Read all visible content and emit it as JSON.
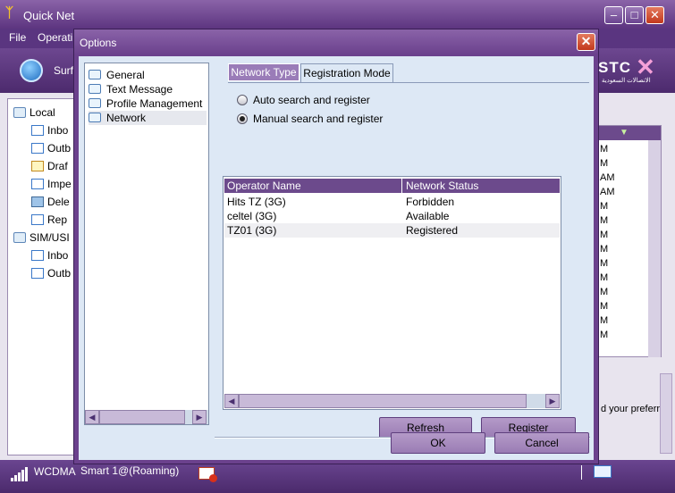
{
  "app": {
    "title": "Quick Net",
    "menu": [
      "File",
      "Operati"
    ],
    "toolbar_label": "Surf",
    "brand": {
      "name": "STC",
      "tagline": "الاتصالات السعودية"
    },
    "tree": [
      {
        "label": "Local",
        "icon": "folder-icon"
      },
      {
        "label": "Inbo",
        "icon": "inbox-icon"
      },
      {
        "label": "Outb",
        "icon": "outbox-icon"
      },
      {
        "label": "Draf",
        "icon": "drafts-icon"
      },
      {
        "label": "Impe",
        "icon": "important-icon"
      },
      {
        "label": "Dele",
        "icon": "trash-icon"
      },
      {
        "label": "Rep",
        "icon": "report-icon"
      },
      {
        "label": "SIM/USI",
        "icon": "folder-icon"
      },
      {
        "label": "Inbo",
        "icon": "inbox-icon"
      },
      {
        "label": "Outb",
        "icon": "outbox-icon"
      }
    ],
    "list_times": [
      "M",
      "M",
      "AM",
      "AM",
      "M",
      "M",
      "M",
      "M",
      "M",
      "M",
      "M",
      "M",
      "M",
      "M"
    ],
    "side_note": "d your preferr"
  },
  "statusbar": {
    "network_type": "WCDMA",
    "operator": "Smart 1@(Roaming)"
  },
  "dialog": {
    "title": "Options",
    "tree": [
      {
        "label": "General",
        "selected": false
      },
      {
        "label": "Text Message",
        "selected": false
      },
      {
        "label": "Profile Management",
        "selected": false
      },
      {
        "label": "Network",
        "selected": true
      }
    ],
    "tabs": [
      {
        "label": "Network Type",
        "active": false
      },
      {
        "label": "Registration Mode",
        "active": true
      }
    ],
    "radios": [
      {
        "label": "Auto search and register",
        "checked": false
      },
      {
        "label": "Manual search and register",
        "checked": true
      }
    ],
    "table": {
      "headers": [
        "Operator Name",
        "Network Status"
      ],
      "rows": [
        [
          "Hits TZ (3G)",
          "Forbidden"
        ],
        [
          "celtel (3G)",
          "Available"
        ],
        [
          "TZ01 (3G)",
          "Registered"
        ]
      ]
    },
    "buttons": {
      "refresh": "Refresh",
      "register": "Register",
      "ok": "OK",
      "cancel": "Cancel"
    }
  }
}
